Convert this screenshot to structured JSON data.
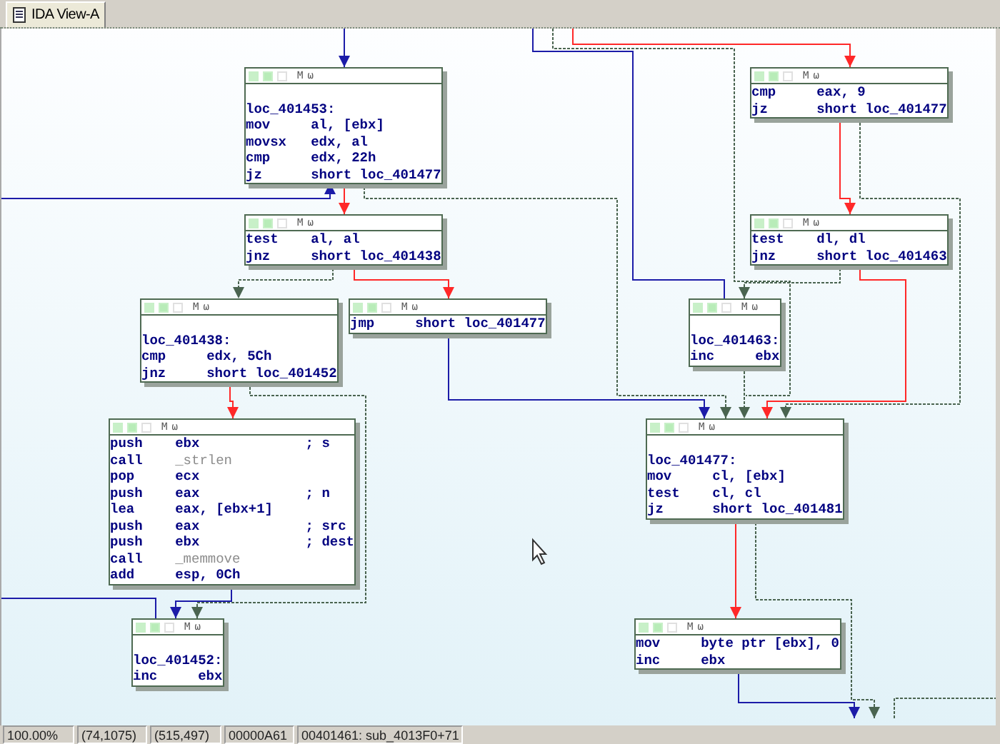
{
  "tab": {
    "label": "IDA View-A",
    "selected": true
  },
  "nodes": [
    {
      "header": [
        "M",
        "ω"
      ],
      "label": "loc_401453:",
      "lines": [
        {
          "mnemonic": "mov",
          "operand": "al, [ebx]",
          "kind": "code"
        },
        {
          "mnemonic": "movsx",
          "operand": "edx, al",
          "kind": "code"
        },
        {
          "mnemonic": "cmp",
          "operand": "edx, 22h",
          "kind": "code"
        },
        {
          "mnemonic": "jz",
          "operand": "short loc_401477",
          "kind": "code"
        }
      ]
    },
    {
      "header": [
        "M",
        "ω"
      ],
      "lines": [
        {
          "mnemonic": "test",
          "operand": "al, al",
          "kind": "code"
        },
        {
          "mnemonic": "jnz",
          "operand": "short loc_401438",
          "kind": "code"
        }
      ]
    },
    {
      "header": [
        "M",
        "ω"
      ],
      "label": "loc_401438:",
      "lines": [
        {
          "mnemonic": "cmp",
          "operand": "edx, 5Ch",
          "kind": "code"
        },
        {
          "mnemonic": "jnz",
          "operand": "short loc_401452",
          "kind": "code"
        }
      ]
    },
    {
      "header": [
        "M",
        "ω"
      ],
      "lines": [
        {
          "mnemonic": "jmp",
          "operand": "short loc_401477",
          "kind": "code"
        }
      ]
    },
    {
      "header": [
        "M",
        "ω"
      ],
      "lines": [
        {
          "mnemonic": "cmp",
          "operand": "eax, 9",
          "kind": "code"
        },
        {
          "mnemonic": "jz",
          "operand": "short loc_401477",
          "kind": "code"
        }
      ]
    },
    {
      "header": [
        "M",
        "ω"
      ],
      "lines": [
        {
          "mnemonic": "test",
          "operand": "dl, dl",
          "kind": "code"
        },
        {
          "mnemonic": "jnz",
          "operand": "short loc_401463",
          "kind": "code"
        }
      ]
    },
    {
      "header": [
        "M",
        "ω"
      ],
      "label": "loc_401463:",
      "lines": [
        {
          "mnemonic": "inc",
          "operand": "ebx",
          "kind": "code"
        }
      ]
    },
    {
      "header": [
        "M",
        "ω"
      ],
      "lines": [
        {
          "mnemonic": "push",
          "operand": "ebx",
          "comment": "; s",
          "kind": "code"
        },
        {
          "mnemonic": "call",
          "operand": "_strlen",
          "kind": "import"
        },
        {
          "mnemonic": "pop",
          "operand": "ecx",
          "kind": "code"
        },
        {
          "mnemonic": "push",
          "operand": "eax",
          "comment": "; n",
          "kind": "code"
        },
        {
          "mnemonic": "lea",
          "operand": "eax, [ebx+1]",
          "kind": "code"
        },
        {
          "mnemonic": "push",
          "operand": "eax",
          "comment": "; src",
          "kind": "code"
        },
        {
          "mnemonic": "push",
          "operand": "ebx",
          "comment": "; dest",
          "kind": "code"
        },
        {
          "mnemonic": "call",
          "operand": "_memmove",
          "kind": "import"
        },
        {
          "mnemonic": "add",
          "operand": "esp, 0Ch",
          "kind": "code"
        }
      ]
    },
    {
      "header": [
        "M",
        "ω"
      ],
      "label": "loc_401452:",
      "lines": [
        {
          "mnemonic": "inc",
          "operand": "ebx",
          "kind": "code"
        }
      ]
    },
    {
      "header": [
        "M",
        "ω"
      ],
      "label": "loc_401477:",
      "lines": [
        {
          "mnemonic": "mov",
          "operand": "cl, [ebx]",
          "kind": "code"
        },
        {
          "mnemonic": "test",
          "operand": "cl, cl",
          "kind": "code"
        },
        {
          "mnemonic": "jz",
          "operand": "short loc_401481",
          "kind": "code"
        }
      ]
    },
    {
      "header": [
        "M",
        "ω"
      ],
      "lines": [
        {
          "mnemonic": "mov",
          "operand": "byte ptr [ebx], 0",
          "kind": "code"
        },
        {
          "mnemonic": "inc",
          "operand": "ebx",
          "kind": "code"
        }
      ]
    }
  ],
  "edges": [
    {
      "kind": "unconditional"
    },
    {
      "kind": "unconditional"
    },
    {
      "kind": "false_branch"
    },
    {
      "kind": "true_branch"
    },
    {
      "kind": "true_branch"
    },
    {
      "kind": "false_branch"
    },
    {
      "kind": "unconditional"
    },
    {
      "kind": "unconditional"
    },
    {
      "kind": "true_branch"
    },
    {
      "kind": "false_branch"
    },
    {
      "kind": "false_branch"
    },
    {
      "kind": "true_branch"
    },
    {
      "kind": "false_branch"
    },
    {
      "kind": "true_branch"
    },
    {
      "kind": "true_branch"
    },
    {
      "kind": "false_branch"
    },
    {
      "kind": "true_branch"
    },
    {
      "kind": "unconditional"
    },
    {
      "kind": "unconditional"
    },
    {
      "kind": "false_branch"
    },
    {
      "kind": "true_branch"
    },
    {
      "kind": "unconditional"
    },
    {
      "kind": "true_branch"
    }
  ],
  "status_bar": [
    "100.00%",
    "(74,1075)",
    "(515,497)",
    "00000A61",
    "00401461: sub_4013F0+71"
  ]
}
